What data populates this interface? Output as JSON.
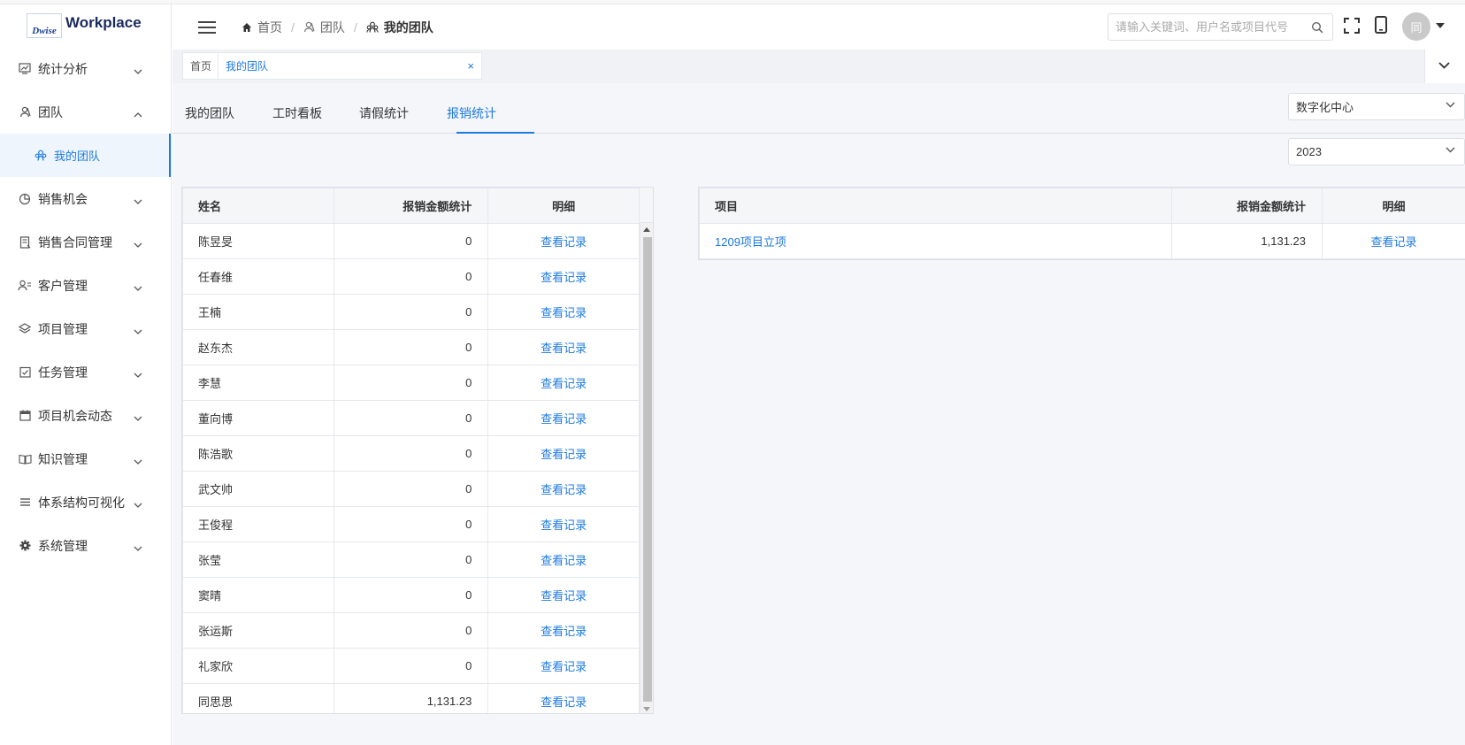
{
  "app": {
    "logo_mark": "Dwise",
    "logo_text": "Workplace"
  },
  "sidebar": {
    "items": [
      {
        "label": "统计分析",
        "icon": "chart-icon",
        "expanded": false
      },
      {
        "label": "团队",
        "icon": "team-icon",
        "expanded": true
      },
      {
        "label": "我的团队",
        "icon": "group-icon",
        "sub": true,
        "active": true
      },
      {
        "label": "销售机会",
        "icon": "pie-icon",
        "expanded": false
      },
      {
        "label": "销售合同管理",
        "icon": "contract-icon",
        "expanded": false
      },
      {
        "label": "客户管理",
        "icon": "customer-icon",
        "expanded": false
      },
      {
        "label": "项目管理",
        "icon": "layers-icon",
        "expanded": false
      },
      {
        "label": "任务管理",
        "icon": "task-icon",
        "expanded": false
      },
      {
        "label": "项目机会动态",
        "icon": "calendar-icon",
        "expanded": false
      },
      {
        "label": "知识管理",
        "icon": "book-icon",
        "expanded": false
      },
      {
        "label": "体系结构可视化",
        "icon": "menu-lines-icon",
        "expanded": false
      },
      {
        "label": "系统管理",
        "icon": "gear-icon",
        "expanded": false
      }
    ]
  },
  "header": {
    "breadcrumb": [
      "首页",
      "团队",
      "我的团队"
    ],
    "search_placeholder": "请输入关键词、用户名或项目代号",
    "avatar_text": "同"
  },
  "tagbar": {
    "home": "首页",
    "active": "我的团队",
    "close": "×"
  },
  "tabs": [
    "我的团队",
    "工时看板",
    "请假统计",
    "报销统计"
  ],
  "active_tab": "报销统计",
  "filters": {
    "department": "数字化中心",
    "year": "2023"
  },
  "left_table": {
    "headers": {
      "name": "姓名",
      "amount": "报销金额统计",
      "detail": "明细"
    },
    "rows": [
      {
        "name": "陈昱旻",
        "amount": "0",
        "detail": "查看记录"
      },
      {
        "name": "任春维",
        "amount": "0",
        "detail": "查看记录"
      },
      {
        "name": "王楠",
        "amount": "0",
        "detail": "查看记录"
      },
      {
        "name": "赵东杰",
        "amount": "0",
        "detail": "查看记录"
      },
      {
        "name": "李慧",
        "amount": "0",
        "detail": "查看记录"
      },
      {
        "name": "董向博",
        "amount": "0",
        "detail": "查看记录"
      },
      {
        "name": "陈浩歌",
        "amount": "0",
        "detail": "查看记录"
      },
      {
        "name": "武文帅",
        "amount": "0",
        "detail": "查看记录"
      },
      {
        "name": "王俊程",
        "amount": "0",
        "detail": "查看记录"
      },
      {
        "name": "张莹",
        "amount": "0",
        "detail": "查看记录"
      },
      {
        "name": "窦晴",
        "amount": "0",
        "detail": "查看记录"
      },
      {
        "name": "张运斯",
        "amount": "0",
        "detail": "查看记录"
      },
      {
        "name": "礼家欣",
        "amount": "0",
        "detail": "查看记录"
      },
      {
        "name": "同思思",
        "amount": "1,131.23",
        "detail": "查看记录"
      }
    ]
  },
  "right_table": {
    "headers": {
      "project": "项目",
      "amount": "报销金额统计",
      "detail": "明细"
    },
    "rows": [
      {
        "project": "1209项目立项",
        "amount": "1,131.23",
        "detail": "查看记录"
      }
    ]
  },
  "colors": {
    "accent": "#1e7ae0",
    "bg": "#f4f6f9"
  }
}
